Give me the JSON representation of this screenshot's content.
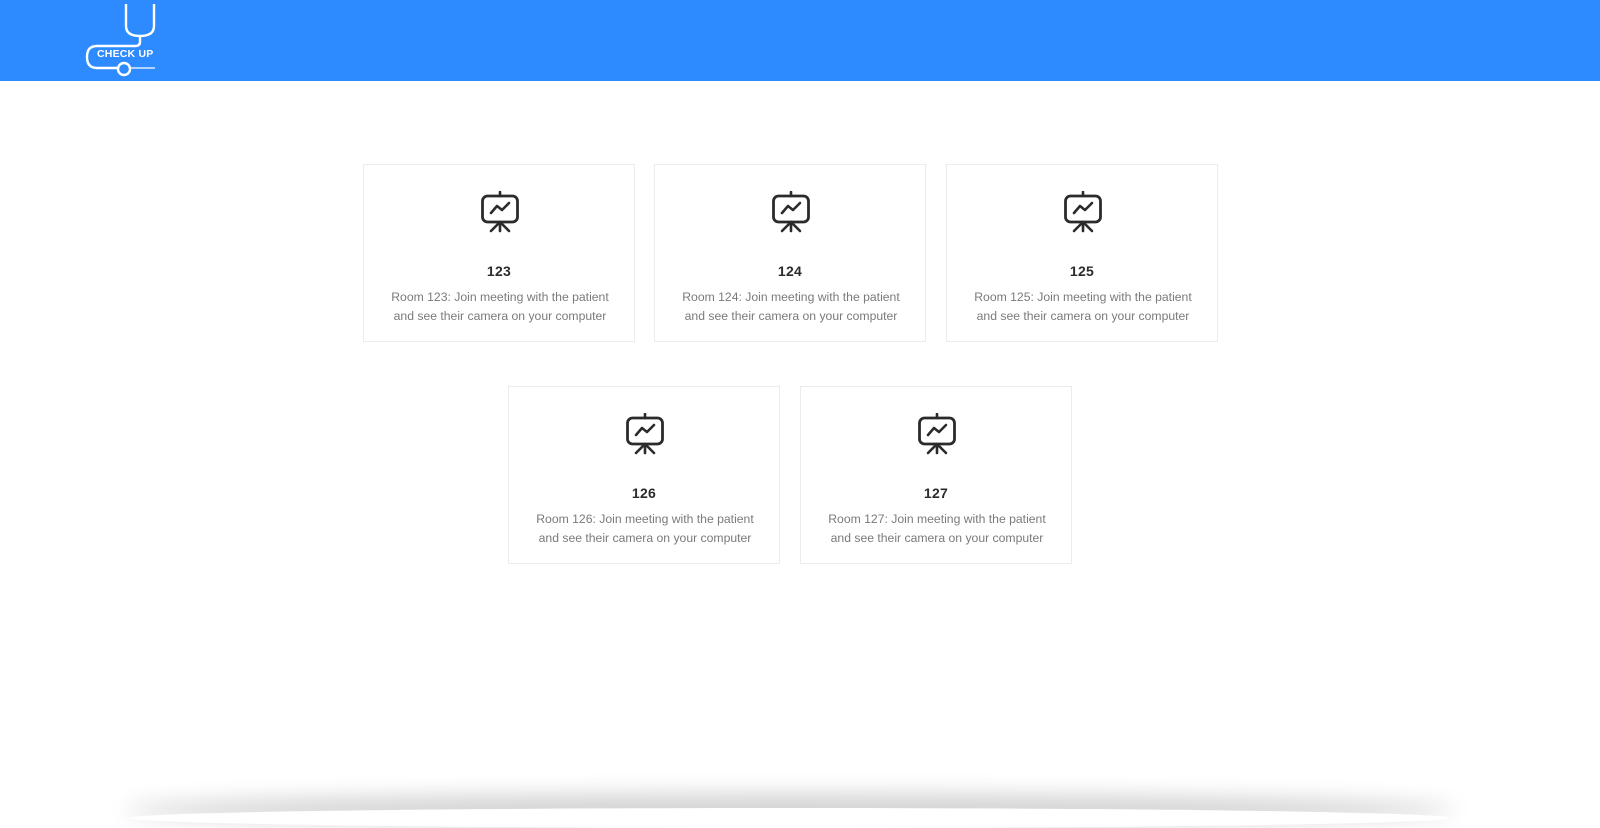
{
  "header": {
    "brand_color": "#2e8bff",
    "logo_text": "CHECK UP",
    "logo_icon": "stethoscope-icon"
  },
  "rooms": [
    {
      "number": "123",
      "description": "Room 123: Join meeting with the patient and see their camera on your computer",
      "icon": "presentation-board-icon"
    },
    {
      "number": "124",
      "description": "Room 124: Join meeting with the patient and see their camera on your computer",
      "icon": "presentation-board-icon"
    },
    {
      "number": "125",
      "description": "Room 125: Join meeting with the patient and see their camera on your computer",
      "icon": "presentation-board-icon"
    },
    {
      "number": "126",
      "description": "Room 126: Join meeting with the patient and see their camera on your computer",
      "icon": "presentation-board-icon"
    },
    {
      "number": "127",
      "description": "Room 127: Join meeting with the patient and see their camera on your computer",
      "icon": "presentation-board-icon"
    }
  ]
}
